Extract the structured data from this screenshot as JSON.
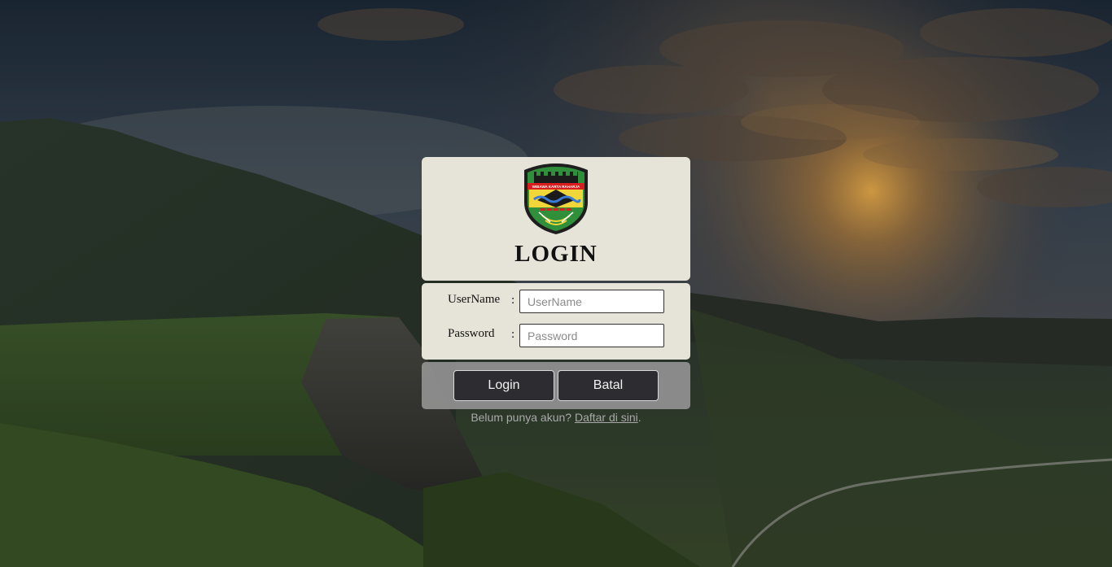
{
  "header": {
    "title": "LOGIN",
    "logo_icon": "regency-crest-logo",
    "logo_motto": "WIBAWA KARTA RAHARJA"
  },
  "form": {
    "username_label": "UserName",
    "username_colon": ":",
    "username_placeholder": "UserName",
    "username_value": "",
    "password_label": "Password",
    "password_colon": ":",
    "password_placeholder": "Password",
    "password_value": ""
  },
  "actions": {
    "login_label": "Login",
    "cancel_label": "Batal"
  },
  "register": {
    "prompt": "Belum punya akun?",
    "link_label": "Daftar di sini",
    "suffix": "."
  },
  "colors": {
    "panel_bg": "#e6e4d8",
    "button_bg": "#2c2c31",
    "button_bar_bg": "#969696",
    "link_text": "#a9a9a9"
  }
}
